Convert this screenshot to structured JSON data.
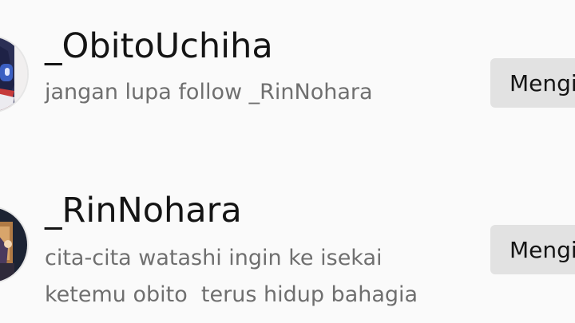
{
  "suggestions": [
    {
      "avatar_icon": "anime-character-avatar",
      "username": "_ObitoUchiha",
      "bio_lines": [
        "jangan lupa follow _RinNohara"
      ],
      "button_label": "Mengi"
    },
    {
      "avatar_icon": "anime-character-avatar",
      "username": "_RinNohara",
      "bio_lines": [
        "cita-cita watashi ingin ke isekai",
        "ketemu obito  terus hidup bahagia"
      ],
      "button_label": "Mengi"
    }
  ],
  "colors": {
    "background": "#fafafa",
    "username_text": "#141414",
    "bio_text": "#6f6f6f",
    "button_bg": "#e2e2e2"
  }
}
